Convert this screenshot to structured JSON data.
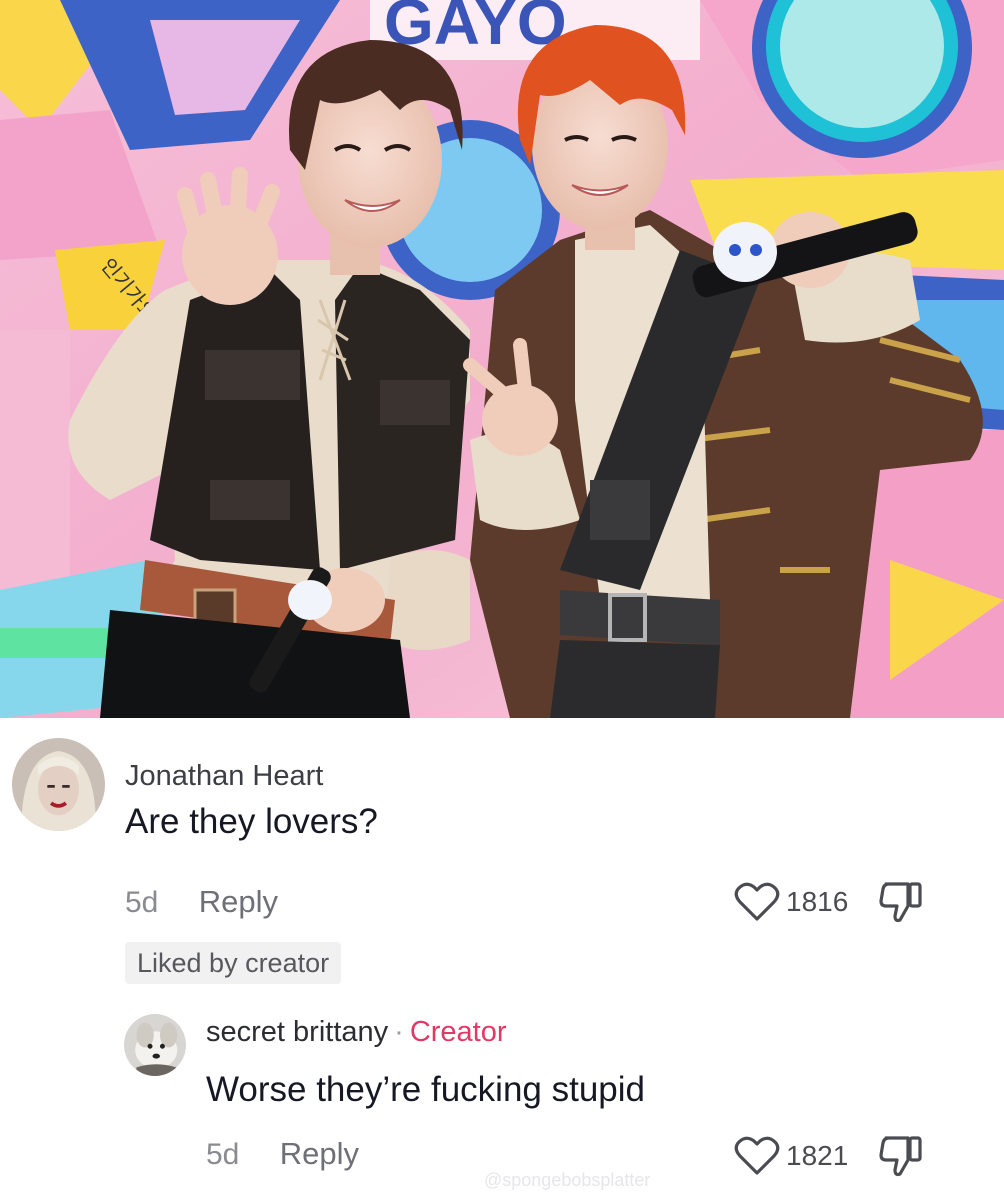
{
  "photo": {
    "sign_text": "GAYO",
    "side_text": "인기가요"
  },
  "comments": [
    {
      "username": "Jonathan Heart",
      "text": "Are they lovers?",
      "time": "5d",
      "reply_label": "Reply",
      "likes": "1816",
      "badge": "Liked by creator"
    },
    {
      "username": "secret brittany",
      "separator": "·",
      "role": "Creator",
      "text": "Worse they’re fucking stupid",
      "time": "5d",
      "reply_label": "Reply",
      "likes": "1821"
    }
  ],
  "watermark": "@spongebobsplatter",
  "colors": {
    "creator_accent": "#e23866",
    "text_primary": "#161823",
    "text_secondary": "#8a8b91",
    "badge_bg": "#f1f1f2"
  },
  "icons": [
    "heart-icon",
    "dislike-icon"
  ]
}
